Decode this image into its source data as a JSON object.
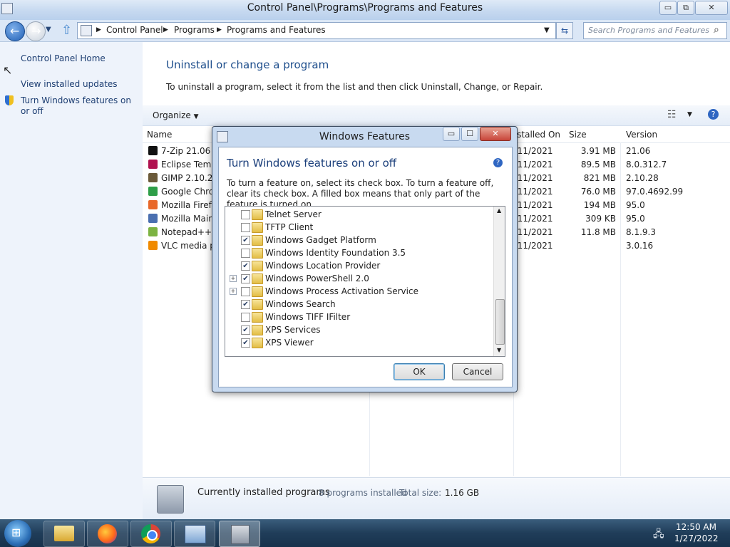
{
  "window": {
    "title": "Control Panel\\Programs\\Programs and Features",
    "minimize": "▭",
    "restore": "⧉",
    "close": "✕"
  },
  "nav": {
    "crumbs": [
      "Control Panel",
      "Programs",
      "Programs and Features"
    ],
    "search_placeholder": "Search Programs and Features"
  },
  "left_pane": {
    "home": "Control Panel Home",
    "updates": "View installed updates",
    "features": "Turn Windows features on or off"
  },
  "main": {
    "heading": "Uninstall or change a program",
    "instructions": "To uninstall a program, select it from the list and then click Uninstall, Change, or Repair.",
    "organize": "Organize",
    "columns": {
      "name": "Name",
      "installed_on": "Installed On",
      "size": "Size",
      "version": "Version"
    },
    "programs": [
      {
        "name": "7-Zip 21.06",
        "installed": "2/11/2021",
        "size": "3.91 MB",
        "version": "21.06",
        "icon_color": "#111111"
      },
      {
        "name": "Eclipse Temu",
        "installed": "2/11/2021",
        "size": "89.5 MB",
        "version": "8.0.312.7",
        "icon_color": "#b0124f"
      },
      {
        "name": "GIMP 2.10.28",
        "installed": "2/11/2021",
        "size": "821 MB",
        "version": "2.10.28",
        "icon_color": "#6b5a3a"
      },
      {
        "name": "Google Chror",
        "installed": "2/11/2021",
        "size": "76.0 MB",
        "version": "97.0.4692.99",
        "icon_color": "#2e9e48"
      },
      {
        "name": "Mozilla Firefo",
        "installed": "2/11/2021",
        "size": "194 MB",
        "version": "95.0",
        "icon_color": "#e8682a"
      },
      {
        "name": "Mozilla Maint",
        "installed": "2/11/2021",
        "size": "309 KB",
        "version": "95.0",
        "icon_color": "#4a6fb0"
      },
      {
        "name": "Notepad++ (",
        "installed": "2/11/2021",
        "size": "11.8 MB",
        "version": "8.1.9.3",
        "icon_color": "#7cb342"
      },
      {
        "name": "VLC media pl",
        "installed": "2/11/2021",
        "size": "",
        "version": "3.0.16",
        "icon_color": "#f08a00"
      }
    ]
  },
  "status": {
    "label": "Currently installed programs",
    "count": "8 programs installed",
    "total_label": "Total size:",
    "total_value": "1.16 GB"
  },
  "dialog": {
    "title": "Windows Features",
    "heading": "Turn Windows features on or off",
    "description": "To turn a feature on, select its check box. To turn a feature off, clear its check box. A filled box means that only part of the feature is turned on.",
    "features": [
      {
        "label": "Telnet Server",
        "checked": false,
        "expandable": false
      },
      {
        "label": "TFTP Client",
        "checked": false,
        "expandable": false
      },
      {
        "label": "Windows Gadget Platform",
        "checked": true,
        "expandable": false
      },
      {
        "label": "Windows Identity Foundation 3.5",
        "checked": false,
        "expandable": false
      },
      {
        "label": "Windows Location Provider",
        "checked": true,
        "expandable": false
      },
      {
        "label": "Windows PowerShell 2.0",
        "checked": true,
        "expandable": true
      },
      {
        "label": "Windows Process Activation Service",
        "checked": false,
        "expandable": true
      },
      {
        "label": "Windows Search",
        "checked": true,
        "expandable": false
      },
      {
        "label": "Windows TIFF IFilter",
        "checked": false,
        "expandable": false
      },
      {
        "label": "XPS Services",
        "checked": true,
        "expandable": false
      },
      {
        "label": "XPS Viewer",
        "checked": true,
        "expandable": false
      }
    ],
    "ok": "OK",
    "cancel": "Cancel",
    "help": "?"
  },
  "taskbar": {
    "time": "12:50 AM",
    "date": "1/27/2022"
  },
  "colors": {
    "heading_blue": "#1e4e8c",
    "dialog_heading": "#1a3e7a",
    "close_red": "#c8453a"
  }
}
